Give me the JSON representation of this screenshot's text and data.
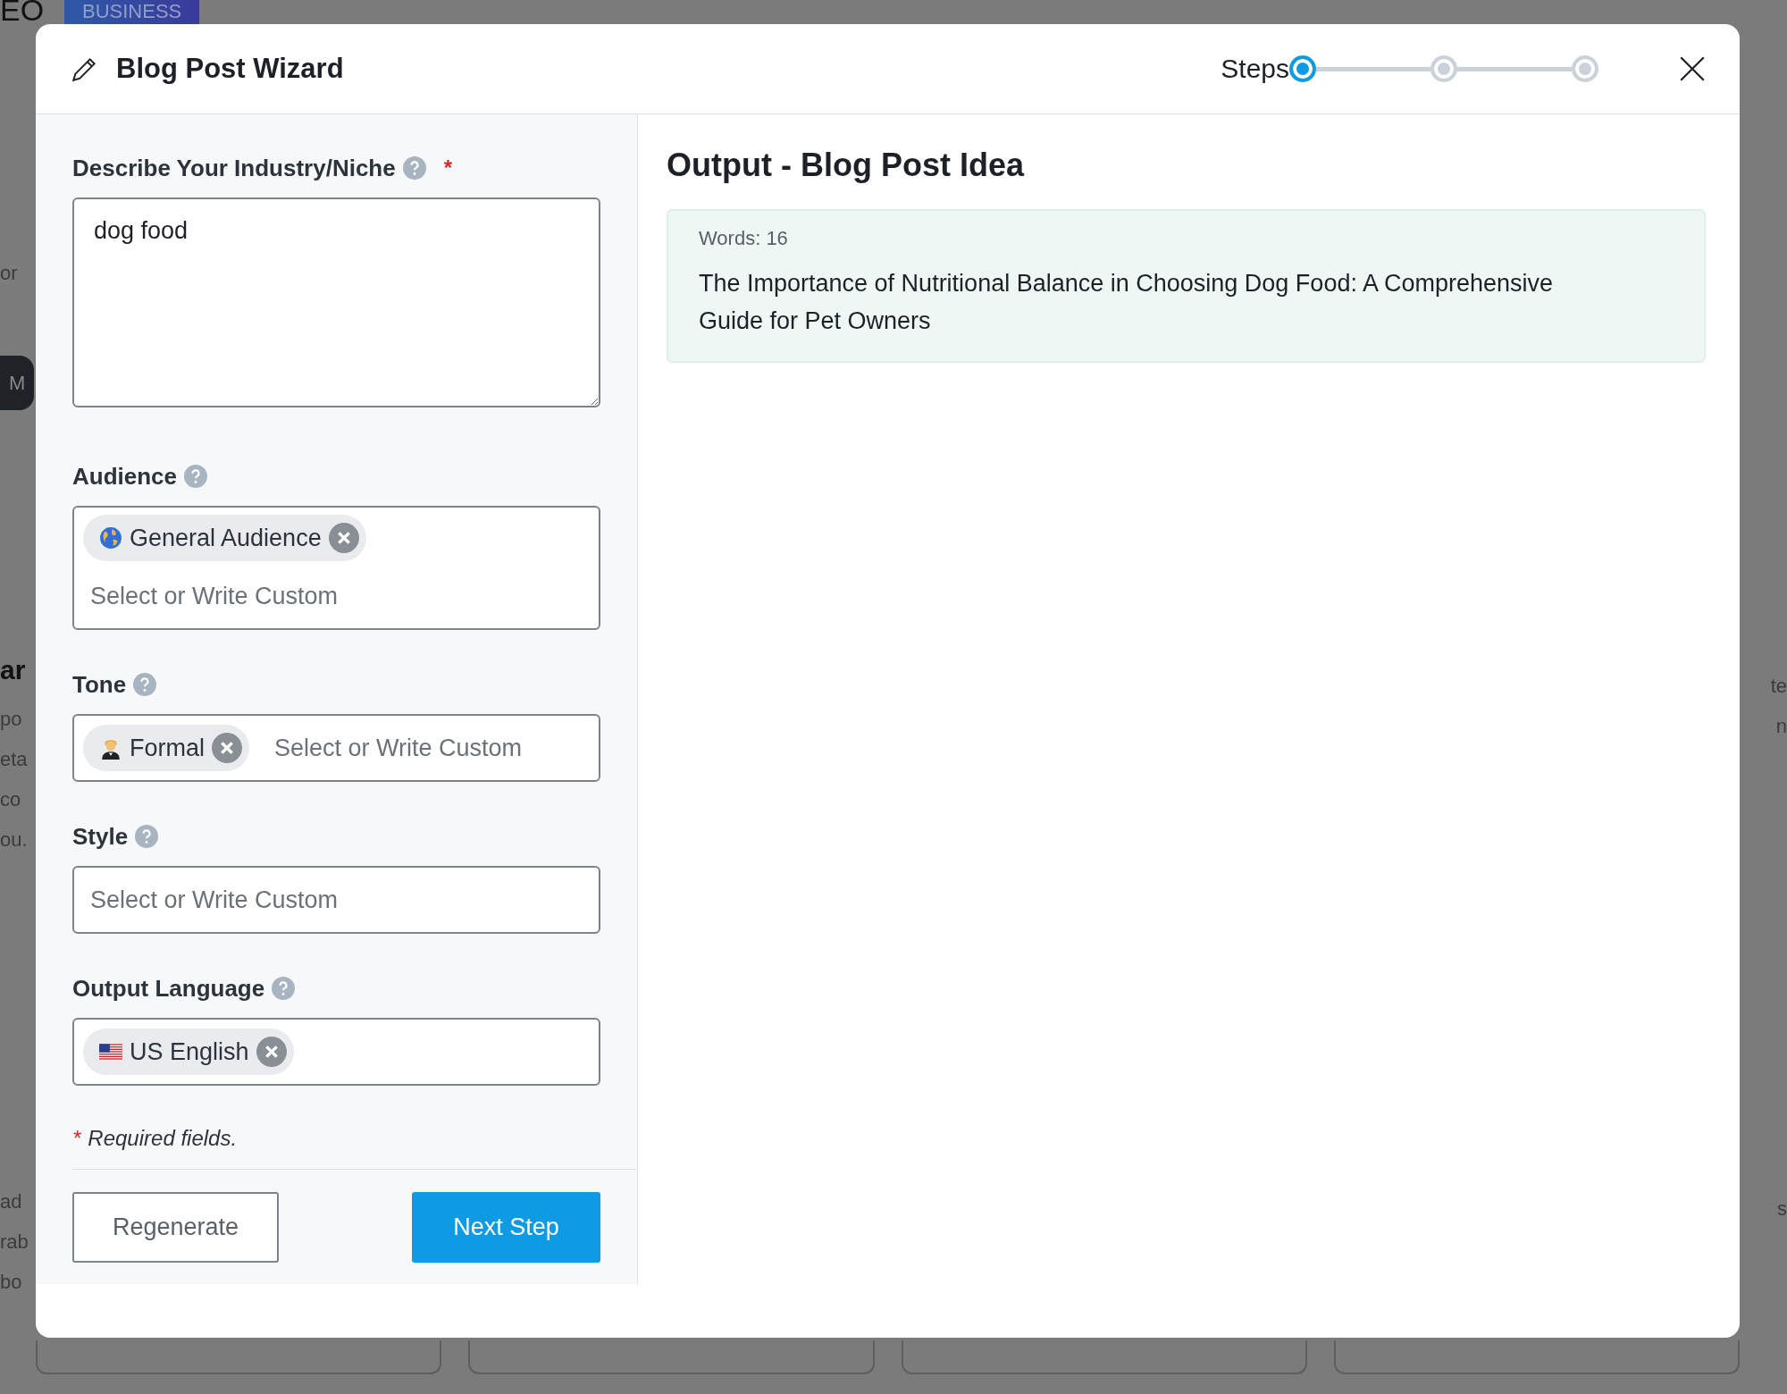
{
  "background": {
    "logo": "EO",
    "badge": "BUSINESS",
    "left_fragments": [
      {
        "kind": "plain",
        "text": "or"
      },
      {
        "kind": "pill",
        "text": "M"
      },
      {
        "kind": "heading",
        "text": "ar"
      },
      {
        "kind": "plain",
        "text": "po"
      },
      {
        "kind": "plain",
        "text": "eta"
      },
      {
        "kind": "plain",
        "text": "co"
      },
      {
        "kind": "plain",
        "text": "ou."
      },
      {
        "kind": "plain",
        "text": "ad"
      },
      {
        "kind": "plain",
        "text": "rab"
      },
      {
        "kind": "plain",
        "text": "bo"
      }
    ],
    "right_fragments": [
      "te",
      "n",
      "s"
    ]
  },
  "modal": {
    "title": "Blog Post Wizard",
    "steps_label": "Steps",
    "steps": [
      {
        "selected": true
      },
      {
        "selected": false
      },
      {
        "selected": false
      }
    ]
  },
  "form": {
    "fields": [
      {
        "kind": "textarea",
        "label": "Describe Your Industry/Niche",
        "required": true,
        "value": "dog food"
      },
      {
        "kind": "tags",
        "label": "Audience",
        "required": false,
        "tags": [
          "General Audience"
        ],
        "placeholder": "Select or Write Custom"
      },
      {
        "kind": "tags",
        "label": "Tone",
        "required": false,
        "tags": [
          "Formal"
        ],
        "placeholder": "Select or Write Custom"
      },
      {
        "kind": "tags",
        "label": "Style",
        "required": false,
        "placeholder": "Select or Write Custom"
      },
      {
        "kind": "tags",
        "label": "Output Language",
        "required": false,
        "tags": [
          "US English"
        ]
      }
    ],
    "required_mark": "*",
    "required_note": "Required fields.",
    "buttons": [
      {
        "kind": "secondary",
        "label": "Regenerate"
      },
      {
        "kind": "primary",
        "label": "Next Step"
      }
    ]
  },
  "output": {
    "heading": "Output - Blog Post Idea",
    "word_count": "Words: 16",
    "text": "The Importance of Nutritional Balance in Choosing Dog Food: A Comprehensive Guide for Pet Owners"
  }
}
